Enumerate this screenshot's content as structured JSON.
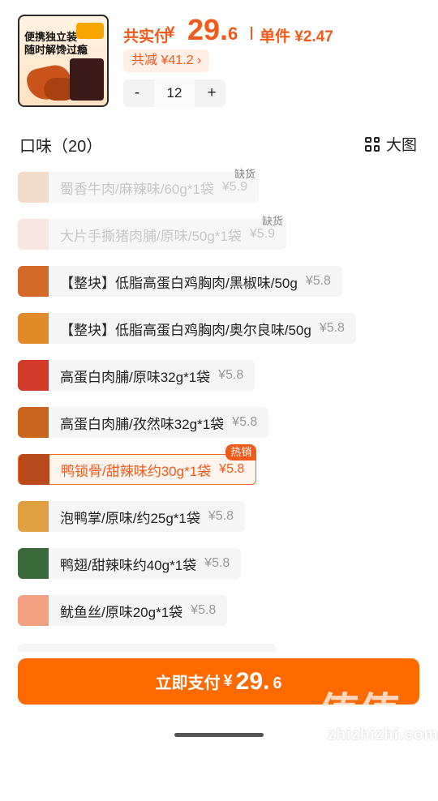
{
  "header": {
    "thumb_caption": "",
    "thumb_text_1": "便携独立装",
    "thumb_text_2": "随时解馋过瘾",
    "total_label": "共实付",
    "currency": "¥",
    "total_int": "29.",
    "total_dec": "6",
    "unit_label": "单件 ¥2.47",
    "discount_label": "共减 ¥41.2 ›",
    "quantity": "12",
    "minus": "-",
    "plus": "+"
  },
  "section": {
    "title": "口味（20）",
    "view_label": "大图"
  },
  "items": [
    {
      "name": "蜀香牛肉/麻辣味/60g*1袋",
      "price": "¥5.9",
      "status": "缺货",
      "state": "disabled",
      "img": "#e8a872"
    },
    {
      "name": "大片手撕猪肉脯/原味/50g*1袋",
      "price": "¥5.9",
      "status": "缺货",
      "state": "disabled",
      "img": "#f4c2b8"
    },
    {
      "name": "【整块】低脂高蛋白鸡胸肉/黑椒味/50g",
      "price": "¥5.8",
      "status": "",
      "state": "normal",
      "img": "#d46a2a"
    },
    {
      "name": "【整块】低脂高蛋白鸡胸肉/奥尔良味/50g",
      "price": "¥5.8",
      "status": "",
      "state": "normal",
      "img": "#e08a2a"
    },
    {
      "name": "高蛋白肉脯/原味32g*1袋",
      "price": "¥5.8",
      "status": "",
      "state": "normal",
      "img": "#d23a2a"
    },
    {
      "name": "高蛋白肉脯/孜然味32g*1袋",
      "price": "¥5.8",
      "status": "",
      "state": "normal",
      "img": "#c8641c"
    },
    {
      "name": "鸭锁骨/甜辣味约30g*1袋",
      "price": "¥5.8",
      "status": "热销",
      "state": "selected",
      "img": "#b84a1c"
    },
    {
      "name": "泡鸭掌/原味/约25g*1袋",
      "price": "¥5.8",
      "status": "",
      "state": "normal",
      "img": "#e0a040"
    },
    {
      "name": "鸭翅/甜辣味约40g*1袋",
      "price": "¥5.8",
      "status": "",
      "state": "normal",
      "img": "#3a6a3a"
    },
    {
      "name": "鱿鱼丝/原味20g*1袋",
      "price": "¥5.8",
      "status": "",
      "state": "normal",
      "img": "#f0a080"
    }
  ],
  "footer": {
    "pay_label": "立即支付",
    "currency": "¥",
    "amount_int": "29.",
    "amount_dec": "6"
  },
  "watermark": {
    "text": "值值值",
    "url": "zhizhizhi.com"
  },
  "colors": {
    "accent": "#f05a1a",
    "button": "#ff6a00"
  }
}
